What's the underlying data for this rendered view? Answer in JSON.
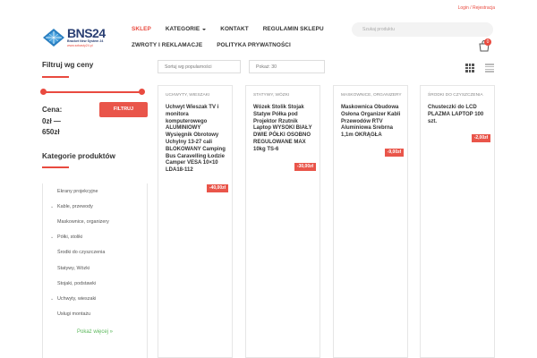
{
  "top_links": {
    "login": "Login",
    "separator": " / ",
    "register": "Rejestracja"
  },
  "logo": {
    "title": "BNS24",
    "subtitle": "Bracket New System 24",
    "url": "www.sxbasty24.pl"
  },
  "nav": {
    "row1": [
      {
        "label": "SKLEP",
        "active": true,
        "dropdown": false
      },
      {
        "label": "KATEGORIE",
        "active": false,
        "dropdown": true
      },
      {
        "label": "KONTAKT",
        "active": false,
        "dropdown": false
      },
      {
        "label": "REGULAMIN SKLEPU",
        "active": false,
        "dropdown": false
      }
    ],
    "row2": [
      {
        "label": "ZWROTY I REKLAMACJE"
      },
      {
        "label": "POLITYKA PRYWATNOŚCI"
      }
    ]
  },
  "search": {
    "placeholder": "Szukaj produktu"
  },
  "cart": {
    "count": "0"
  },
  "price_filter": {
    "title": "Filtruj wg ceny",
    "price_prefix": "Cena:",
    "min_price": "0zł",
    "dash": "—",
    "max_price": "650zł",
    "button_label": "FILTRUJ"
  },
  "categories": {
    "title": "Kategorie produktów",
    "items": [
      {
        "label": "Ekrany projekcyjne",
        "expandable": false
      },
      {
        "label": "Kable, przewody",
        "expandable": true
      },
      {
        "label": "Maskownice, organizery",
        "expandable": false
      },
      {
        "label": "Półki, stoliki",
        "expandable": true
      },
      {
        "label": "Środki do czyszczenia",
        "expandable": false
      },
      {
        "label": "Statywy, Wózki",
        "expandable": false
      },
      {
        "label": "Stojaki, podstawki",
        "expandable": false
      },
      {
        "label": "Uchwyty, wieszaki",
        "expandable": true
      },
      {
        "label": "Usługi montażu",
        "expandable": false
      }
    ],
    "show_more": "Pokaż więcej »"
  },
  "toolbar": {
    "sort_label": "Sortuj wg popularności",
    "per_page_label": "Pokaż: 30"
  },
  "products": [
    {
      "category": "UCHWYTY, WIESZAKI",
      "title": "Uchwyt Wieszak TV i monitora komputerowego ALUMINIOWY Wysięgnik Obrotowy Uchylny 13-27 cali BLOKOWANY Camping Bus Caravelling Łodzie Camper VESA 10×10 LDA18-112",
      "discount": "-40,00zł"
    },
    {
      "category": "STATYWY, WÓZKI",
      "title": "Wózek Stolik Stojak Statyw Półka pod Projektor Rzutnik Laptop WYSOKI BIAŁY DWIE PÓŁKI OSOBNO REGULOWANE MAX 10kg TS-6",
      "discount": "-30,00zł"
    },
    {
      "category": "MASKOWNICE, ORGANIZERY",
      "title": "Maskownica Obudowa Osłona Organizer Kabli Przewodów RTV Aluminiowa Srebrna 1,1m OKRĄGŁA",
      "discount": "-9,00zł"
    },
    {
      "category": "ŚRODKI DO CZYSZCZENIA",
      "title": "Chusteczki do LCD PLAZMA LAPTOP 100 szt.",
      "discount": "-2,00zł"
    }
  ],
  "colors": {
    "accent": "#e94a3f",
    "brand": "#2a3f73",
    "link_green": "#5cb85c"
  }
}
